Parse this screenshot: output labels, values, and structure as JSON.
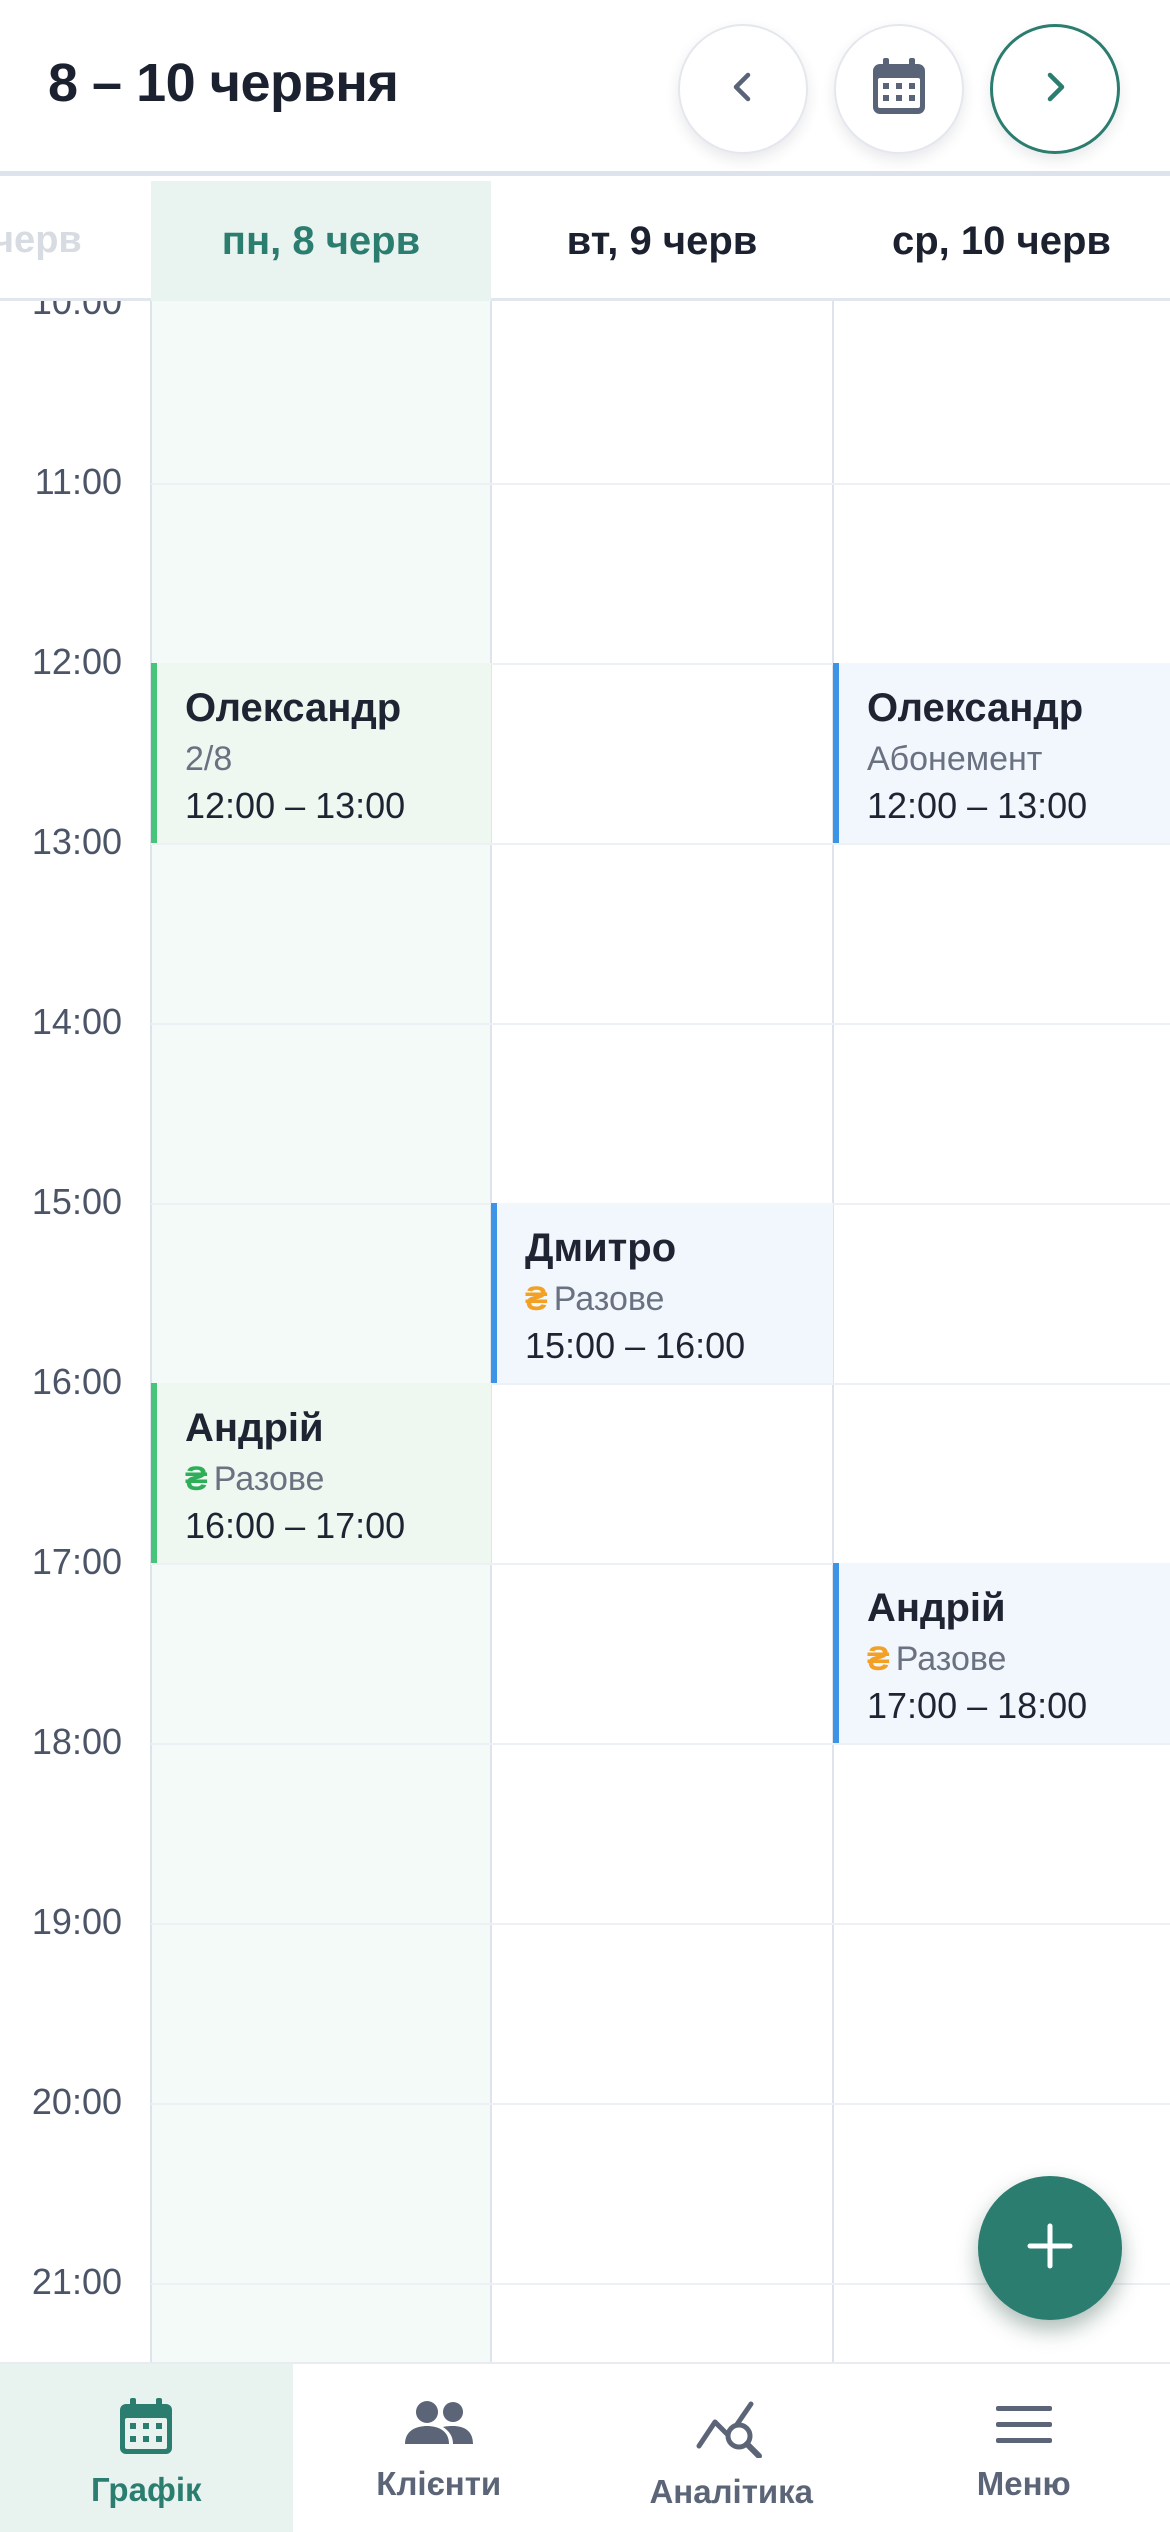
{
  "header": {
    "title": "8 – 10 червня",
    "prev_icon": "chevron-left-icon",
    "calendar_icon": "calendar-icon",
    "next_icon": "chevron-right-icon"
  },
  "ghost_day_label": "черв",
  "days": [
    {
      "label": "пн, 8 черв",
      "active": true
    },
    {
      "label": "вт, 9 черв",
      "active": false
    },
    {
      "label": "ср, 10 черв",
      "active": false
    }
  ],
  "times": [
    "10:00",
    "11:00",
    "12:00",
    "13:00",
    "14:00",
    "15:00",
    "16:00",
    "17:00",
    "18:00",
    "19:00",
    "20:00",
    "21:00"
  ],
  "events": [
    {
      "name": "Олександр",
      "type": "2/8",
      "time": "12:00 – 13:00"
    },
    {
      "name": "Андрій",
      "type": "Разове",
      "currency": "₴",
      "time": "16:00 – 17:00"
    },
    {
      "name": "Дмитро",
      "type": "Разове",
      "currency": "₴",
      "time": "15:00 – 16:00"
    },
    {
      "name": "Олександр",
      "type": "Абонемент",
      "time": "12:00 – 13:00"
    },
    {
      "name": "Андрій",
      "type": "Разове",
      "currency": "₴",
      "time": "17:00 – 18:00"
    }
  ],
  "colors": {
    "accent": "#2a7d6f",
    "event_green": "#47c479",
    "event_blue": "#3d93e6",
    "currency_orange": "#f2a125",
    "currency_green": "#2fae5a"
  },
  "fab": {
    "icon": "plus-icon"
  },
  "nav": [
    {
      "label": "Графік",
      "icon": "calendar-icon",
      "active": true
    },
    {
      "label": "Клієнти",
      "icon": "people-icon",
      "active": false
    },
    {
      "label": "Аналітика",
      "icon": "analytics-icon",
      "active": false
    },
    {
      "label": "Меню",
      "icon": "menu-icon",
      "active": false
    }
  ]
}
